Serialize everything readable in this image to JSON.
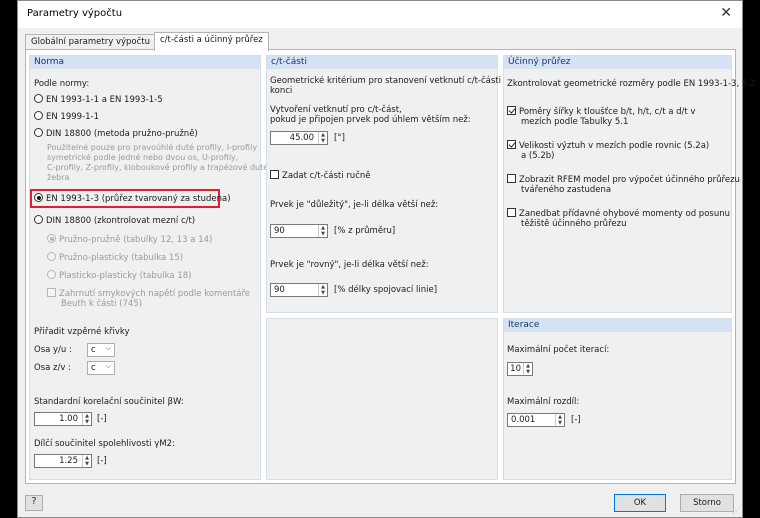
{
  "window": {
    "title": "Parametry výpočtu",
    "close_glyph": "✕"
  },
  "tabs": [
    {
      "label": "Globální parametry výpočtu"
    },
    {
      "label": "c/t-části a účinný průřez"
    }
  ],
  "norma": {
    "header": "Norma",
    "podle_normy": "Podle normy:",
    "options": [
      "EN 1993-1-1 a EN 1993-1-5",
      "EN 1999-1-1",
      "DIN 18800 (metoda pružno-pružně)",
      "EN 1993-1-3 (průřez tvarovaný za studena)",
      "DIN 18800 (zkontrolovat mezní c/t)"
    ],
    "selected_index": 3,
    "din_note": [
      "Použitelné pouze pro pravoúhlé duté profily, I-profily",
      "symetrické podle jedné nebo dvou os, U-profily,",
      "C-profily, Z-profily, kloboukové profily a trapézové duté",
      "žebra"
    ],
    "sub_options": [
      "Pružno-pružně (tabulky 12, 13 a 14)",
      "Pružno-plasticky (tabulka 15)",
      "Plasticko-plasticky (tabulka 18)"
    ],
    "sub_check": [
      "Zahrnutí smykových napětí podle komentáře",
      "Beuth k části (745)"
    ],
    "buckling_label": "Přiřadit vzpěrné křivky",
    "osa_y_label": "Osa y/u :",
    "osa_y_value": "c",
    "osa_z_label": "Osa z/v :",
    "osa_z_value": "c",
    "beta_label": "Standardní korelační součinitel βW:",
    "beta_value": "1.00",
    "beta_unit": "[-]",
    "gamma_label": "Dílčí součinitel spolehlivosti γM2:",
    "gamma_value": "1.25",
    "gamma_unit": "[-]"
  },
  "ct": {
    "header": "c/t-části",
    "desc": [
      "Geometrické kritérium pro stanovení vetknutí c/t-části na",
      "konci"
    ],
    "create_label": [
      "Vytvoření vetknutí pro c/t-část,",
      "pokud je připojen prvek pod úhlem větším než:"
    ],
    "angle_value": "45.00",
    "angle_unit": "[°]",
    "manual_label": "Zadat c/t-části ručně",
    "important_label": "Prvek je \"důležitý\", je-li délka větší než:",
    "important_value": "90",
    "important_unit": "[% z průměru]",
    "straight_label": "Prvek je \"rovný\", je-li délka větší než:",
    "straight_value": "90",
    "straight_unit": "[% délky spojovací linie]"
  },
  "ucinny": {
    "header": "Účinný průřez",
    "desc": "Zkontrolovat geometrické rozměry podle EN 1993-1-3, 5.2",
    "checks": [
      {
        "lines": [
          "Poměry šířky k tloušťce b/t, h/t, c/t a d/t v",
          "mezích podle Tabulky 5.1"
        ],
        "checked": true
      },
      {
        "lines": [
          "Velikosti výztuh v mezích podle rovnic (5.2a)",
          "a (5.2b)"
        ],
        "checked": true
      },
      {
        "lines": [
          "Zobrazit RFEM model pro výpočet účinného průřezu",
          "tvářeného zastudena"
        ],
        "checked": false
      },
      {
        "lines": [
          "Zanedbat přídavné ohybové momenty od posunu",
          "těžiště účinného průřezu"
        ],
        "checked": false
      }
    ]
  },
  "iterace": {
    "header": "Iterace",
    "max_iter_label": "Maximální počet iterací:",
    "max_iter_value": "10",
    "max_diff_label": "Maximální rozdíl:",
    "max_diff_value": "0.001",
    "max_diff_unit": "[-]"
  },
  "footer": {
    "ok": "OK",
    "cancel": "Storno",
    "help_glyph": "?"
  }
}
